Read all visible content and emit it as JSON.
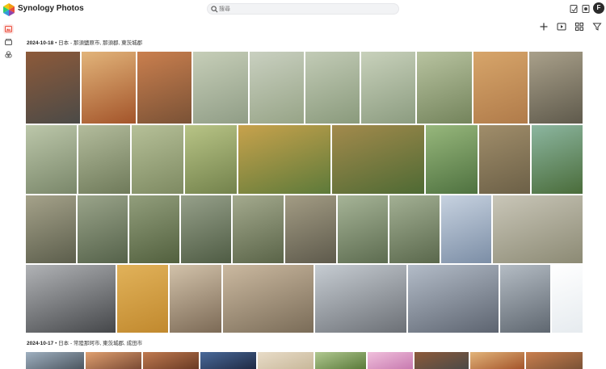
{
  "app": {
    "title": "Synology Photos"
  },
  "search": {
    "placeholder": "搜尋"
  },
  "header_icons": [
    "notes-icon",
    "device-icon",
    "grid-apps-icon",
    "user-avatar"
  ],
  "avatar": {
    "initial": "F"
  },
  "sidebar": {
    "items": [
      "photo-library-icon",
      "shared-space-icon",
      "albums-icon"
    ]
  },
  "toolbar": {
    "icons": [
      "add-icon",
      "slideshow-icon",
      "view-grid-icon",
      "filter-icon"
    ]
  },
  "colors": {
    "accent": "#ea4d3c",
    "logo": [
      "#f39c12",
      "#e74c3c",
      "#8e44ad",
      "#3498db"
    ]
  },
  "sections": [
    {
      "date": "2024-10-18",
      "separator": "•",
      "place": "日本 - 那須鹽原市, 那須郡, 東茨城郡"
    },
    {
      "date": "2024-10-17",
      "separator": "•",
      "place": "日本 - 常陸那珂市, 東茨城郡, 成田市"
    }
  ],
  "photos": [
    [
      "#4b4a47",
      "#8d5a3a"
    ],
    [
      "#a3542a",
      "#e2b47a"
    ],
    [
      "#7a5236",
      "#ca7f4e"
    ],
    [
      "#909d86",
      "#c6ceb8"
    ],
    [
      "#97a487",
      "#c9d0c0"
    ],
    [
      "#8a9a7c",
      "#c2cbb6"
    ],
    [
      "#8c9c80",
      "#c8d1bb"
    ],
    [
      "#74845c",
      "#b8c3a0"
    ],
    [
      "#b07b4a",
      "#d7a56a"
    ],
    [
      "#5f5a4c",
      "#a9a08a"
    ],
    [
      "#7a876a",
      "#bcc7aa"
    ],
    [
      "#6f7a5a",
      "#b3bc9c"
    ],
    [
      "#7e8a62",
      "#b6c098"
    ],
    [
      "#73824c",
      "#b8c486"
    ],
    [
      "#5d7a3a",
      "#c8a24c"
    ],
    [
      "#4e6a34",
      "#a38a4c"
    ],
    [
      "#4f7240",
      "#97b77c"
    ],
    [
      "#6c6047",
      "#a08d6a"
    ],
    [
      "#4a6c3a",
      "#8cb6a0"
    ],
    [
      "#5c5e4c",
      "#a5a28a"
    ],
    [
      "#55624a",
      "#9aa48a"
    ],
    [
      "#52603e",
      "#929e7c"
    ],
    [
      "#4f5c44",
      "#96a08a"
    ],
    [
      "#5a6448",
      "#a4aa8e"
    ],
    [
      "#5e5a4c",
      "#a39c84"
    ],
    [
      "#5d6c50",
      "#a6b497"
    ],
    [
      "#5a684c",
      "#a3b094"
    ],
    [
      "#7c8ea6",
      "#c7d2e0"
    ],
    [
      "#8c8a74",
      "#c9c6b8"
    ],
    [
      "#45474a",
      "#b1b3b6"
    ],
    [
      "#c1892e",
      "#e1b25a"
    ],
    [
      "#7c6a56",
      "#d2c2aa"
    ],
    [
      "#7a6c58",
      "#cbb9a0"
    ],
    [
      "#6c7076",
      "#c6ccd2"
    ],
    [
      "#5d6470",
      "#b3bcc8"
    ],
    [
      "#5f6770",
      "#b4bcc4"
    ],
    [
      "#e6ebef",
      "#ffffff"
    ],
    [
      "#4c5660",
      "#9fb0c0"
    ],
    [
      "#7a4a34",
      "#e0a070"
    ],
    [
      "#6a3a24",
      "#c07a50"
    ],
    [
      "#1f2a44",
      "#4a6a9a"
    ],
    [
      "#c8b89a",
      "#e8dcc8"
    ],
    [
      "#5a7a3a",
      "#b0c890"
    ],
    [
      "#c87ab0",
      "#f0c0dc"
    ]
  ]
}
